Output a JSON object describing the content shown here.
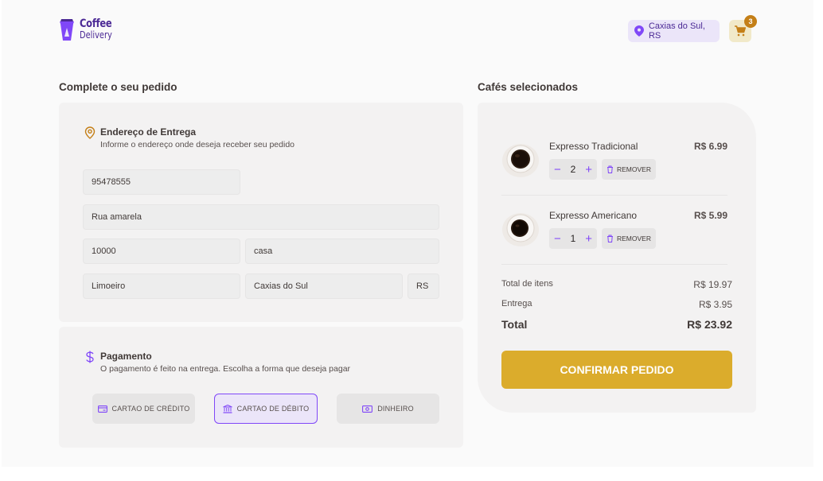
{
  "header": {
    "logo_line1": "Coffee",
    "logo_line2": "Delivery",
    "location": "Caxias do Sul, RS",
    "cart_count": "3"
  },
  "order": {
    "title": "Complete o seu pedido",
    "address": {
      "title": "Endereço de Entrega",
      "subtitle": "Informe o endereço onde deseja receber seu pedido",
      "cep": "95478555",
      "street": "Rua amarela",
      "number": "10000",
      "complement": "casa",
      "neighborhood": "Limoeiro",
      "city": "Caxias do Sul",
      "uf": "RS"
    },
    "payment": {
      "title": "Pagamento",
      "subtitle": "O pagamento é feito na entrega. Escolha a forma que deseja pagar",
      "options": [
        {
          "label": "CARTAO DE CRÉDITO",
          "icon": "credit-card-icon"
        },
        {
          "label": "CARTAO DE DÉBITO",
          "icon": "bank-icon"
        },
        {
          "label": "DINHEIRO",
          "icon": "money-icon"
        }
      ],
      "selected": "CARTAO DE DÉBITO"
    }
  },
  "cart": {
    "title": "Cafés selecionados",
    "items": [
      {
        "name": "Expresso Tradicional",
        "price": "R$ 6.99",
        "qty": "2",
        "remove_label": "REMOVER"
      },
      {
        "name": "Expresso Americano",
        "price": "R$ 5.99",
        "qty": "1",
        "remove_label": "REMOVER"
      }
    ],
    "summary": {
      "items_label": "Total de itens",
      "items_value": "R$ 19.97",
      "delivery_label": "Entrega",
      "delivery_value": "R$ 3.95",
      "total_label": "Total",
      "total_value": "R$ 23.92"
    },
    "confirm_label": "CONFIRMAR PEDIDO"
  },
  "colors": {
    "purple": "#8047f8",
    "purple_dark": "#4b2995",
    "purple_light": "#ebe5f9",
    "yellow": "#dbac2c",
    "yellow_dark": "#c47f17",
    "yellow_light": "#f1e9c9"
  }
}
